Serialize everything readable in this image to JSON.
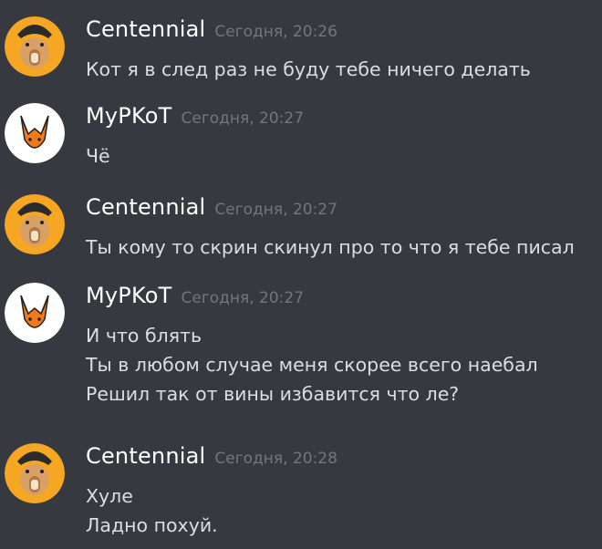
{
  "messages": [
    {
      "author": "Centennial",
      "avatar_icon": "capybara-avatar-icon",
      "timestamp": "Сегодня, 20:26",
      "lines": [
        "Кот я в след раз не буду тебе ничего делать"
      ]
    },
    {
      "author": "MyPKoT",
      "avatar_icon": "fox-avatar-icon",
      "timestamp": "Сегодня, 20:27",
      "lines": [
        "Чё"
      ]
    },
    {
      "author": "Centennial",
      "avatar_icon": "capybara-avatar-icon",
      "timestamp": "Сегодня, 20:27",
      "lines": [
        "Ты кому то скрин скинул про то что я тебе писал"
      ]
    },
    {
      "author": "MyPKoT",
      "avatar_icon": "fox-avatar-icon",
      "timestamp": "Сегодня, 20:27",
      "lines": [
        "И что блять",
        "Ты в любом случае меня скорее всего наебал",
        "Решил так от вины избавится что ле?"
      ]
    },
    {
      "author": "Centennial",
      "avatar_icon": "capybara-avatar-icon",
      "timestamp": "Сегодня, 20:28",
      "lines": [
        "Хуле",
        "Ладно похуй."
      ]
    }
  ],
  "colors": {
    "background": "#36393f",
    "username": "#ffffff",
    "timestamp": "#72767d",
    "message_text": "#dcddde",
    "capybara_bg": "#f5a623",
    "fox_bg": "#ffffff",
    "fox_orange": "#f07a1a"
  }
}
